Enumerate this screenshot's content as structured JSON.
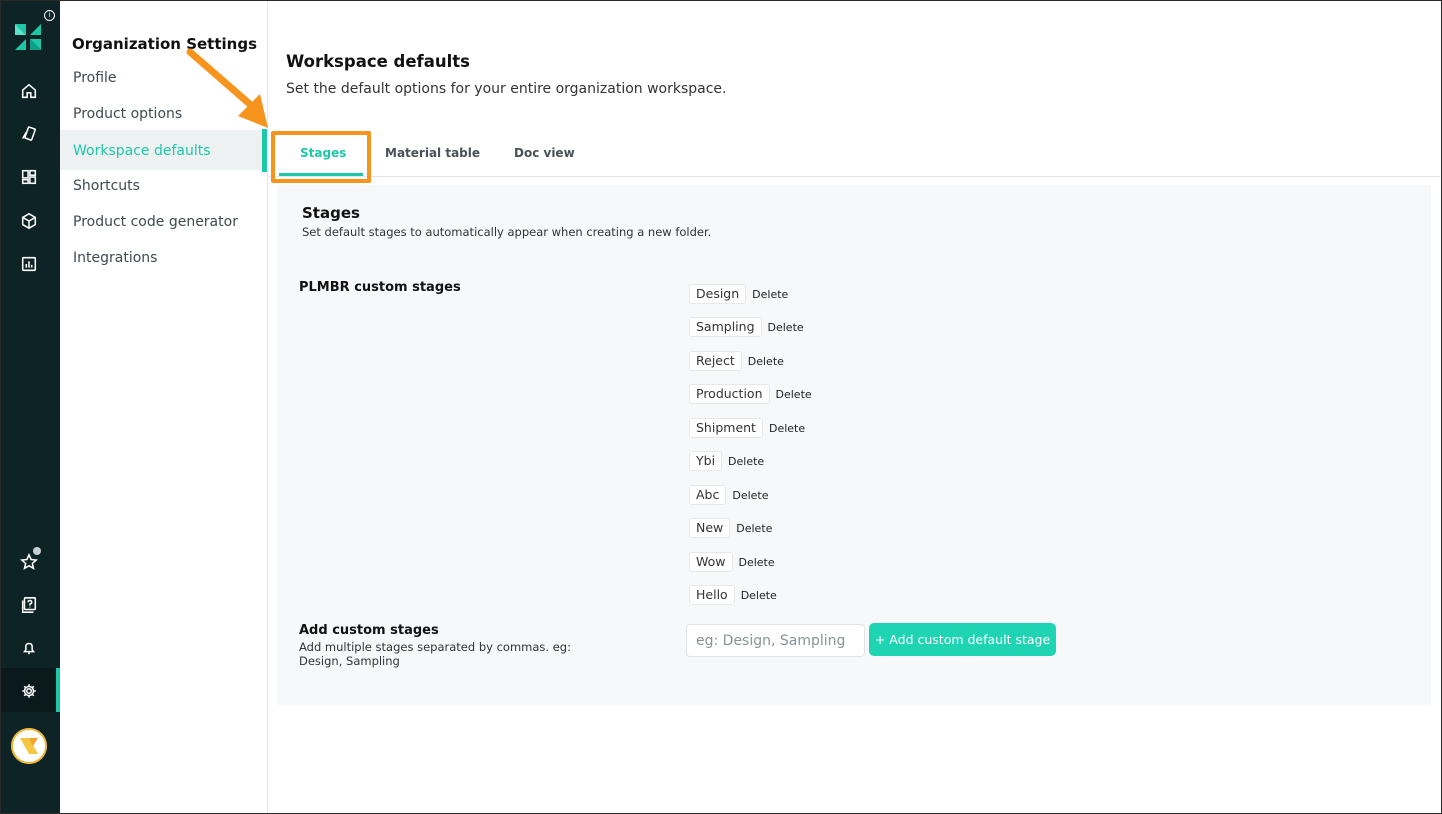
{
  "rail": {
    "icons": [
      "logo-icon",
      "info-icon",
      "home-icon",
      "tag-icon",
      "dashboard-icon",
      "box-icon",
      "chart-icon",
      "star-icon",
      "help-icon",
      "bell-icon",
      "gear-icon",
      "avatar"
    ],
    "info_glyph": "i"
  },
  "subnav": {
    "title": "Organization Settings",
    "items": [
      {
        "label": "Profile"
      },
      {
        "label": "Product options"
      },
      {
        "label": "Workspace defaults",
        "active": true
      },
      {
        "label": "Shortcuts"
      },
      {
        "label": "Product code generator"
      },
      {
        "label": "Integrations"
      }
    ]
  },
  "page": {
    "title": "Workspace defaults",
    "subtitle": "Set the default options for your entire organization workspace."
  },
  "tabs": [
    {
      "label": "Stages",
      "active": true
    },
    {
      "label": "Material table"
    },
    {
      "label": "Doc view"
    }
  ],
  "panel": {
    "title": "Stages",
    "description": "Set default stages to automatically appear when creating a new folder.",
    "custom_label": "PLMBR custom stages",
    "stages": [
      "Design",
      "Sampling",
      "Reject",
      "Production",
      "Shipment",
      "Ybi",
      "Abc",
      "New",
      "Wow",
      "Hello"
    ],
    "delete_label": "Delete",
    "add_label": "Add custom stages",
    "add_help": "Add multiple stages separated by commas. eg: Design, Sampling",
    "input_placeholder": "eg: Design, Sampling",
    "add_button_label": "+ Add custom default stage"
  },
  "colors": {
    "accent": "#1cc8a8",
    "rail_bg": "#0e2326",
    "highlight": "#f7941d"
  }
}
